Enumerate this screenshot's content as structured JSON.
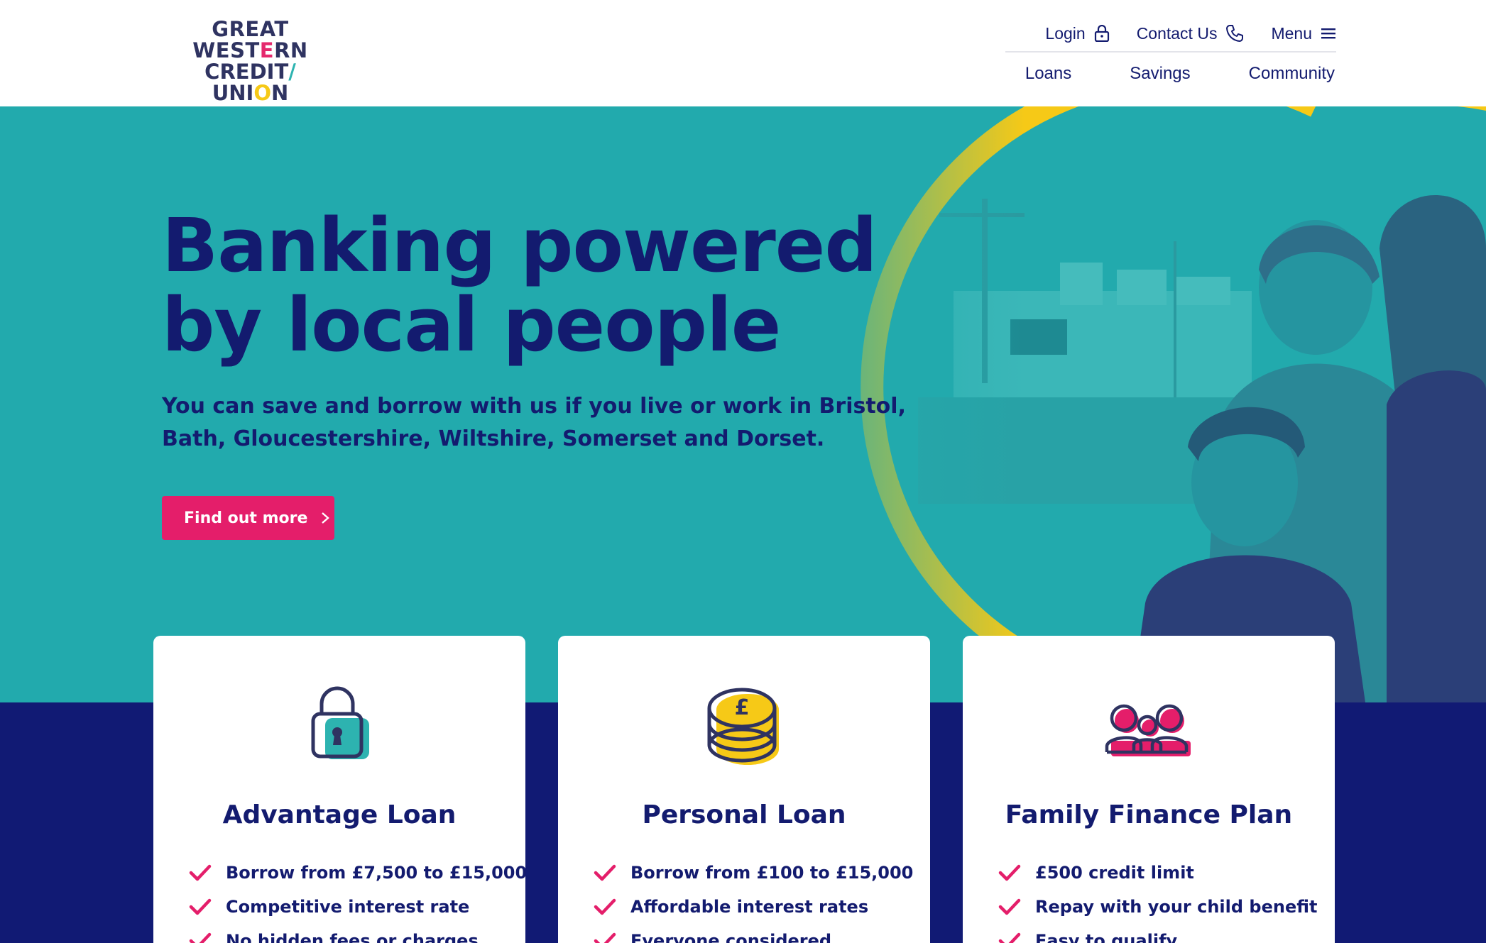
{
  "brand": {
    "logo_line1_a": "GREAT WEST",
    "logo_line1_b": "E",
    "logo_line1_c": "RN",
    "logo_line2_a": "CREDIT",
    "logo_line2_b": "/",
    "logo_line3_a": "UNI",
    "logo_line3_b": "O",
    "logo_line3_c": "N",
    "colors": {
      "navy": "#131b6f",
      "teal": "#22aaad",
      "pink": "#e41e6a",
      "yellow": "#f6c917",
      "band": "#111a74"
    }
  },
  "utility_nav": {
    "login": {
      "label": "Login",
      "icon": "lock-icon"
    },
    "contact": {
      "label": "Contact Us",
      "icon": "phone-icon"
    },
    "menu": {
      "label": "Menu",
      "icon": "hamburger-icon"
    }
  },
  "main_nav": {
    "items": [
      {
        "label": "Loans"
      },
      {
        "label": "Savings"
      },
      {
        "label": "Community"
      }
    ]
  },
  "hero": {
    "title_line1": "Banking powered",
    "title_line2": "by local people",
    "subtitle": "You can save and borrow with us if you live or work in Bristol, Bath, Gloucestershire, Wiltshire, Somerset and Dorset.",
    "cta_label": "Find out more",
    "cta_icon": "chevron-right-icon"
  },
  "cards": [
    {
      "title": "Advantage Loan",
      "icon": "padlock-icon",
      "bullets": [
        "Borrow from £7,500 to £15,000",
        "Competitive interest rate",
        "No hidden fees or charges"
      ]
    },
    {
      "title": "Personal Loan",
      "icon": "coins-icon",
      "icon_text": "£",
      "bullets": [
        "Borrow from £100 to £15,000",
        "Affordable interest rates",
        "Everyone considered"
      ]
    },
    {
      "title": "Family Finance Plan",
      "icon": "family-icon",
      "bullets": [
        "£500 credit limit",
        "Repay with your child benefit",
        "Easy to qualify"
      ]
    }
  ]
}
